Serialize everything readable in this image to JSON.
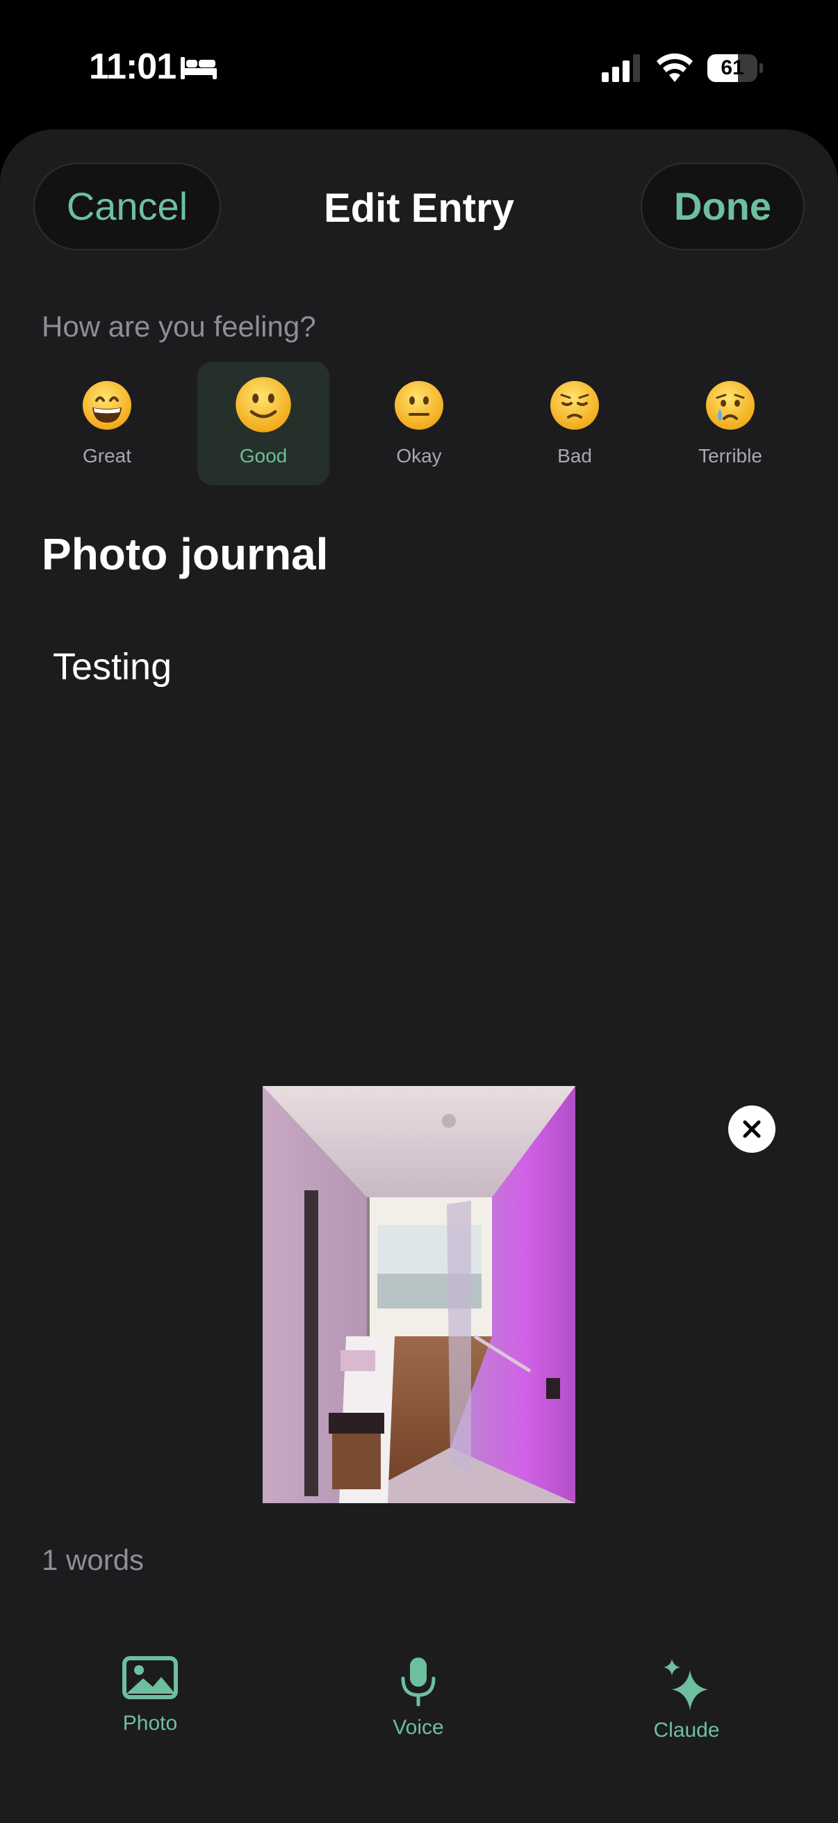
{
  "status_bar": {
    "time": "11:01",
    "battery_percent": "61",
    "battery_level": 0.61
  },
  "nav": {
    "cancel_label": "Cancel",
    "title": "Edit Entry",
    "done_label": "Done"
  },
  "mood": {
    "question": "How are you feeling?",
    "selected": "Good",
    "options": [
      {
        "label": "Great",
        "icon": "grinning-face-emoji"
      },
      {
        "label": "Good",
        "icon": "slightly-smiling-face-emoji"
      },
      {
        "label": "Okay",
        "icon": "neutral-face-emoji"
      },
      {
        "label": "Bad",
        "icon": "pensive-face-emoji"
      },
      {
        "label": "Terrible",
        "icon": "crying-face-emoji"
      }
    ]
  },
  "entry": {
    "title": "Photo journal",
    "body": "Testing"
  },
  "photo": {
    "description_icon": "hotel-bathroom-photo"
  },
  "footer": {
    "word_count": "1 words"
  },
  "toolbar": {
    "photo_label": "Photo",
    "voice_label": "Voice",
    "claude_label": "Claude"
  },
  "colors": {
    "accent": "#6ebf9f",
    "sheet_bg": "#1c1c1e",
    "selected_mood_bg": "#243029"
  }
}
